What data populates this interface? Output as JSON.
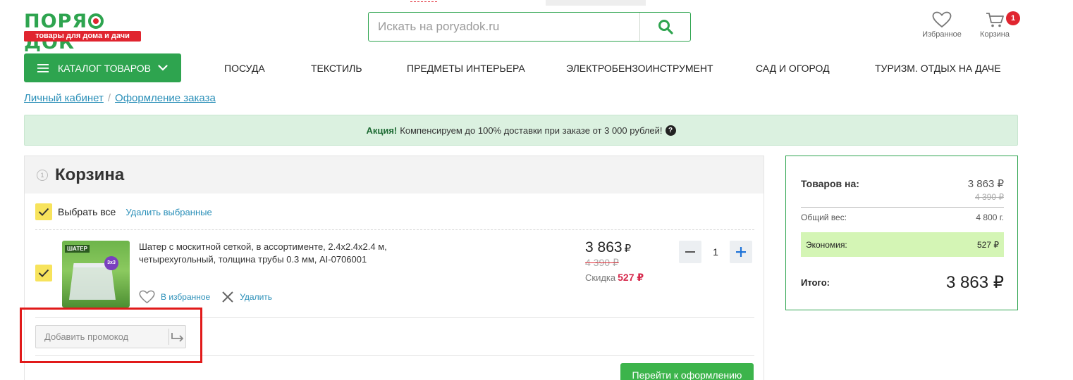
{
  "header": {
    "logo_word_1": "ПОРЯ",
    "logo_word_2": "ДОК",
    "logo_tagline": "товары для дома и дачи",
    "search_placeholder": "Искать на poryadok.ru",
    "favorites_label": "Избранное",
    "cart_label": "Корзина",
    "cart_count": "1"
  },
  "nav": {
    "catalog_label": "КАТАЛОГ ТОВАРОВ",
    "items": [
      "ПОСУДА",
      "ТЕКСТИЛЬ",
      "ПРЕДМЕТЫ ИНТЕРЬЕРА",
      "ЭЛЕКТРОБЕНЗОИНСТРУМЕНТ",
      "САД И ОГОРОД",
      "ТУРИЗМ. ОТДЫХ НА ДАЧЕ"
    ]
  },
  "breadcrumb": {
    "items": [
      "Личный кабинет",
      "Оформление заказа"
    ],
    "separator": "/"
  },
  "banner": {
    "bold": "Акция!",
    "text": "Компенсируем до 100% доставки при заказе от 3 000 рублей!",
    "help_icon": "?"
  },
  "cart": {
    "step": "1",
    "title": "Корзина",
    "select_all": "Выбрать все",
    "delete_selected": "Удалить выбранные",
    "item": {
      "image_label": "ШАТЕР",
      "image_badge": "3x3",
      "name": "Шатер с москитной сеткой, в ассортименте, 2.4х2.4х2.4 м, четырехугольный, толщина трубы 0.3 мм, AI-0706001",
      "add_favorite": "В избранное",
      "remove": "Удалить",
      "price": "3 863",
      "currency": "₽",
      "old_price": "4 390 ₽",
      "discount_label": "Скидка",
      "discount_value": "527 ₽",
      "quantity": "1"
    },
    "promo_placeholder": "Добавить промокод",
    "checkout_label": "Перейти к оформлению"
  },
  "summary": {
    "goods_label": "Товаров на:",
    "goods_value": "3 863 ₽",
    "goods_old": "4 390 ₽",
    "weight_label": "Общий вес:",
    "weight_value": "4 800 г.",
    "savings_label": "Экономия:",
    "savings_value": "527 ₽",
    "total_label": "Итого:",
    "total_value": "3 863 ₽"
  },
  "colors": {
    "brand_green": "#2ea44f",
    "brand_red": "#e0252f",
    "link_blue": "#2a8fb8",
    "checkbox_yellow": "#f7e35c",
    "highlight_frame": "#e11a1a"
  },
  "icons": {
    "search": "search-icon",
    "favorites": "heart-icon",
    "cart": "cart-icon",
    "menu": "menu-icon",
    "chevron": "chevron-down-icon",
    "check": "check-icon",
    "close": "close-icon",
    "minus": "minus-icon",
    "plus": "plus-icon",
    "apply": "arrow-right-icon"
  }
}
